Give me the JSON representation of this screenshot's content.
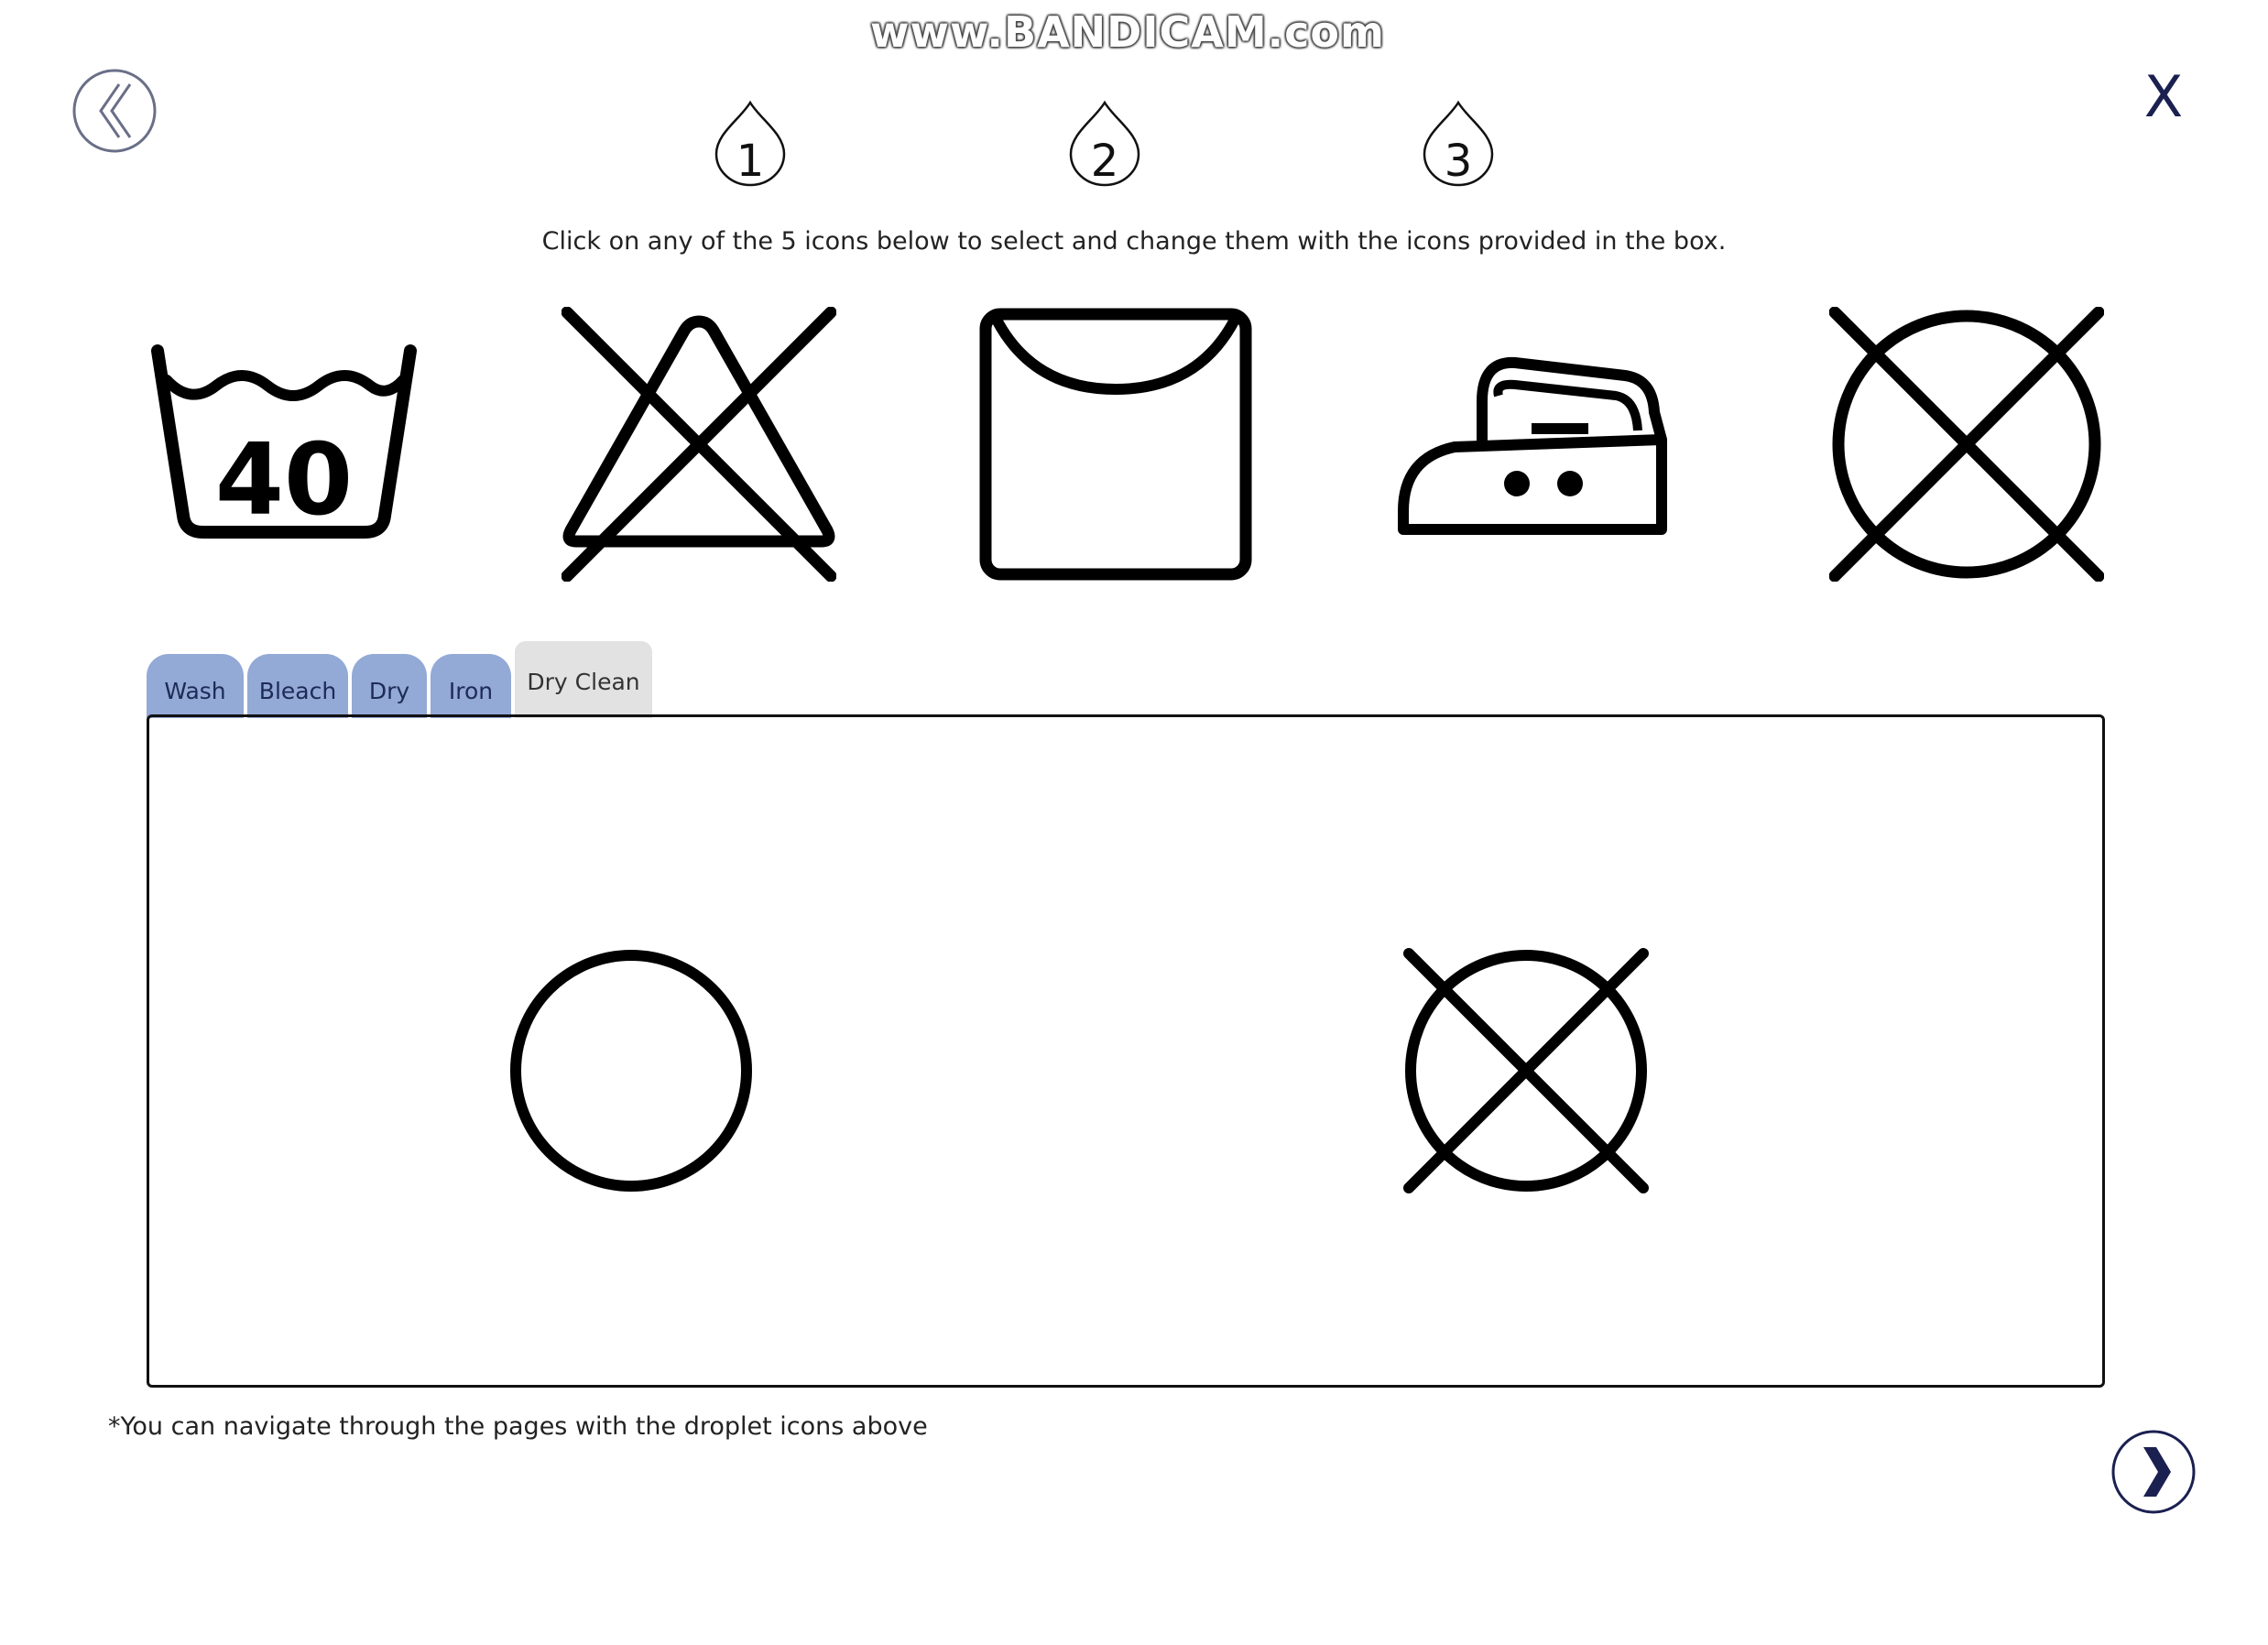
{
  "watermark": "www.BANDICAM.com",
  "nav": {
    "back_icon": "double-chevron-left-icon",
    "close_label": "X",
    "next_icon": "chevron-right-icon"
  },
  "droplets": [
    {
      "label": "1"
    },
    {
      "label": "2"
    },
    {
      "label": "3"
    }
  ],
  "instruction": "Click on any of the 5 icons below to select and change them with the icons provided in the box.",
  "care_icons": [
    {
      "name": "wash-40-icon",
      "text": "40"
    },
    {
      "name": "do-not-bleach-icon"
    },
    {
      "name": "tumble-dry-hanging-icon"
    },
    {
      "name": "iron-two-dots-icon"
    },
    {
      "name": "do-not-dry-clean-icon"
    }
  ],
  "tabs": [
    {
      "label": "Wash",
      "active": false
    },
    {
      "label": "Bleach",
      "active": false
    },
    {
      "label": "Dry",
      "active": false
    },
    {
      "label": "Iron",
      "active": false
    },
    {
      "label": "Dry Clean",
      "active": true
    }
  ],
  "palette_icons": [
    {
      "name": "dry-clean-icon"
    },
    {
      "name": "do-not-dry-clean-icon"
    }
  ],
  "footnote": "*You can navigate through the pages with the droplet icons above",
  "colors": {
    "tab_inactive": "#93a9d6",
    "tab_active": "#e2e2e2",
    "nav_icon": "#1a2050"
  }
}
